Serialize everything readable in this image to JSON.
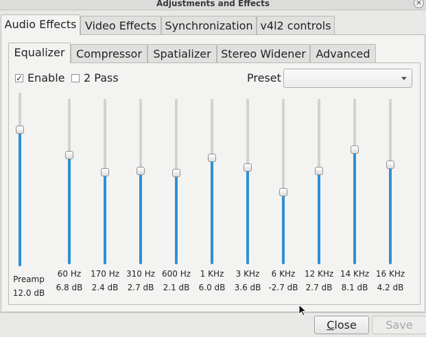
{
  "window": {
    "title": "Adjustments and Effects",
    "close_glyph": "×"
  },
  "main_tabs": [
    {
      "label": "Audio Effects",
      "active": true
    },
    {
      "label": "Video Effects",
      "active": false
    },
    {
      "label": "Synchronization",
      "active": false
    },
    {
      "label": "v4l2 controls",
      "active": false
    }
  ],
  "sub_tabs": [
    {
      "label": "Equalizer",
      "active": true
    },
    {
      "label": "Compressor",
      "active": false
    },
    {
      "label": "Spatializer",
      "active": false
    },
    {
      "label": "Stereo Widener",
      "active": false
    },
    {
      "label": "Advanced",
      "active": false
    }
  ],
  "equalizer": {
    "enable": {
      "label": "Enable",
      "checked": true,
      "glyph": "✓"
    },
    "two_pass": {
      "label": "2 Pass",
      "checked": false
    },
    "preset": {
      "label": "Preset",
      "value": ""
    },
    "range_db": [
      -20,
      20
    ],
    "preamp": {
      "label": "Preamp",
      "value_text": "12.0 dB",
      "value_db": 12.0
    },
    "bands": [
      {
        "freq": "60 Hz",
        "value_text": "6.8 dB",
        "value_db": 6.8
      },
      {
        "freq": "170 Hz",
        "value_text": "2.4 dB",
        "value_db": 2.4
      },
      {
        "freq": "310 Hz",
        "value_text": "2.7 dB",
        "value_db": 2.7
      },
      {
        "freq": "600 Hz",
        "value_text": "2.1 dB",
        "value_db": 2.1
      },
      {
        "freq": "1 KHz",
        "value_text": "6.0 dB",
        "value_db": 6.0
      },
      {
        "freq": "3 KHz",
        "value_text": "3.6 dB",
        "value_db": 3.6
      },
      {
        "freq": "6 KHz",
        "value_text": "-2.7 dB",
        "value_db": -2.7
      },
      {
        "freq": "12 KHz",
        "value_text": "2.7 dB",
        "value_db": 2.7
      },
      {
        "freq": "14 KHz",
        "value_text": "8.1 dB",
        "value_db": 8.1
      },
      {
        "freq": "16 KHz",
        "value_text": "4.2 dB",
        "value_db": 4.2
      }
    ]
  },
  "footer": {
    "close_label": "Close",
    "save_label": "Save",
    "save_enabled": false
  },
  "colors": {
    "accent": "#2f8fd4",
    "track": "#d2d2d1"
  }
}
